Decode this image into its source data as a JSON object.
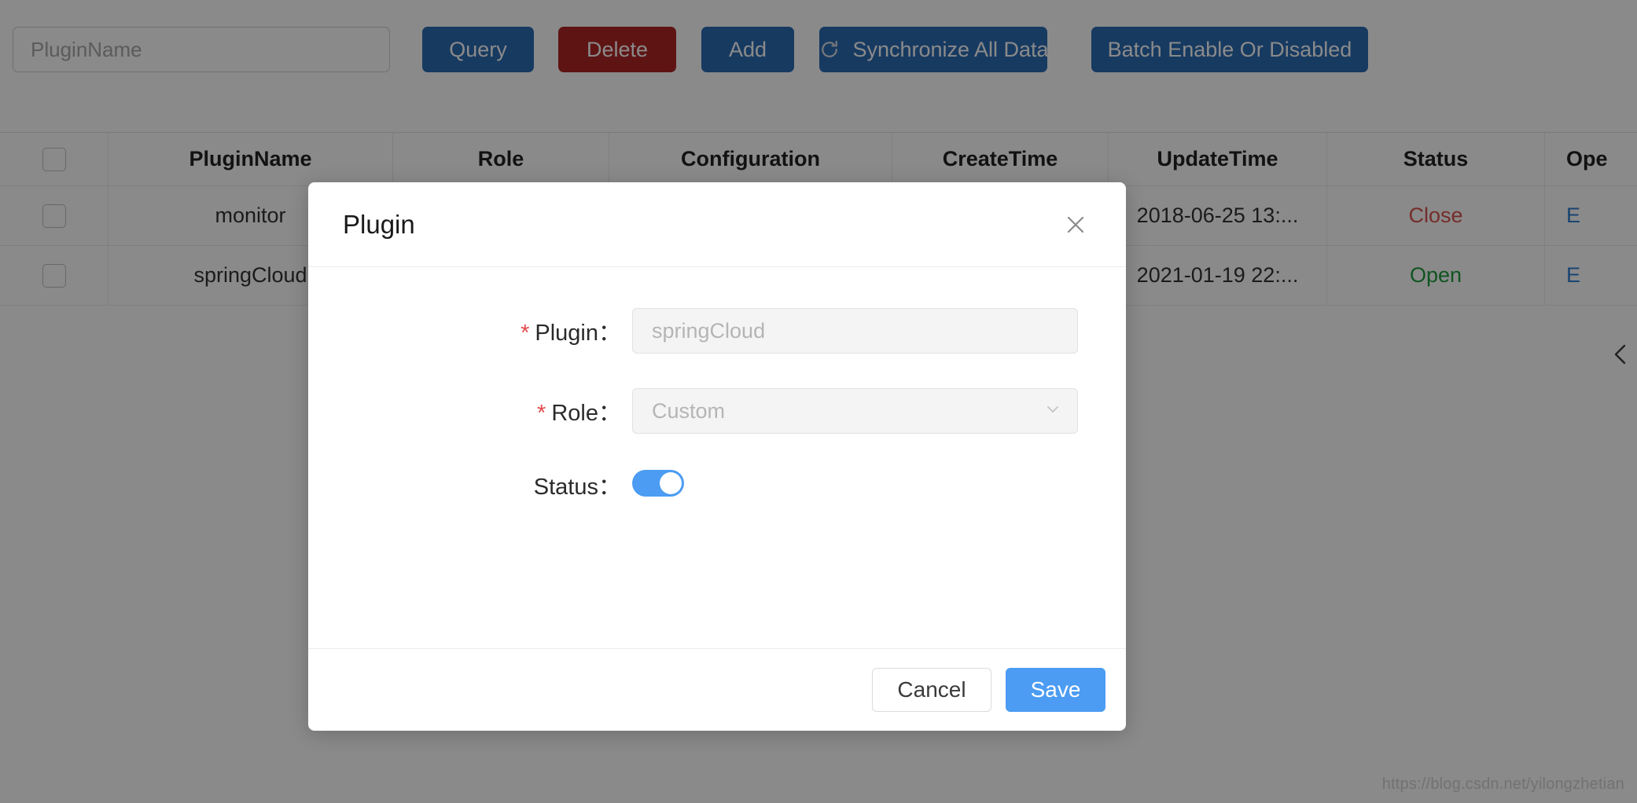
{
  "toolbar": {
    "search_placeholder": "PluginName",
    "search_value": "",
    "query_label": "Query",
    "delete_label": "Delete",
    "add_label": "Add",
    "sync_label": "Synchronize All Data",
    "sync_icon": "refresh-icon",
    "batch_label": "Batch Enable Or Disabled"
  },
  "table": {
    "columns": [
      {
        "key": "check",
        "label": ""
      },
      {
        "key": "name",
        "label": "PluginName"
      },
      {
        "key": "role",
        "label": "Role"
      },
      {
        "key": "config",
        "label": "Configuration"
      },
      {
        "key": "ctime",
        "label": "CreateTime"
      },
      {
        "key": "utime",
        "label": "UpdateTime"
      },
      {
        "key": "status",
        "label": "Status"
      },
      {
        "key": "op",
        "label": "Ope"
      }
    ],
    "rows": [
      {
        "name": "monitor",
        "role": "",
        "config": "",
        "ctime": "",
        "utime": "2018-06-25 13:...",
        "status": "Close",
        "status_color": "#d9534f",
        "op": "E"
      },
      {
        "name": "springCloud",
        "role": "",
        "config": "",
        "ctime": "",
        "utime": "2021-01-19 22:...",
        "status": "Open",
        "status_color": "#1f9d40",
        "op": "E"
      }
    ]
  },
  "collapse_handle": {
    "icon": "chevron-left-icon"
  },
  "watermark": "https://blog.csdn.net/yilongzhetian",
  "modal": {
    "title": "Plugin",
    "close_icon": "close-icon",
    "fields": {
      "plugin": {
        "label": "Plugin",
        "required_mark": "*",
        "colon": "：",
        "placeholder": "springCloud",
        "value": ""
      },
      "role": {
        "label": "Role",
        "required_mark": "*",
        "colon": "：",
        "placeholder": "Custom",
        "value": "",
        "caret_icon": "chevron-down-icon"
      },
      "status": {
        "label": "Status",
        "colon": "：",
        "on": true
      }
    },
    "cancel_label": "Cancel",
    "save_label": "Save"
  },
  "colors": {
    "primary_blue": "#2b6cb4",
    "danger_red": "#b02626",
    "accent_blue": "#4b9cf2",
    "status_close": "#d9534f",
    "status_open": "#1f9d40",
    "link_blue": "#2f7fd1"
  }
}
